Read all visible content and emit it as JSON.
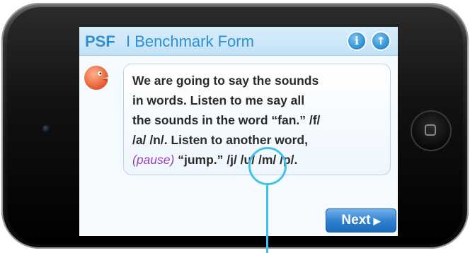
{
  "header": {
    "abbr": "PSF",
    "title": "I Benchmark Form",
    "info_icon": "info-icon",
    "up_icon": "up-arrow-icon",
    "accent_color": "#2f8fd2"
  },
  "prompt": {
    "speaker_icon": "speaker-head-icon",
    "line1": "We are going to say the sounds",
    "line2": "in words. Listen to me say all",
    "line3": "the sounds in the word “fan.” /f/",
    "line4": "/a/ /n/. Listen to another word,",
    "pause": "(pause)",
    "line5_rest": " “jump.” /j/ /u/ /m/ /p/.",
    "pause_color": "#9a3fb5"
  },
  "footer": {
    "next_label": "Next",
    "next_icon": "play-triangle-icon"
  },
  "device": {
    "home_icon": "home-button-icon"
  }
}
